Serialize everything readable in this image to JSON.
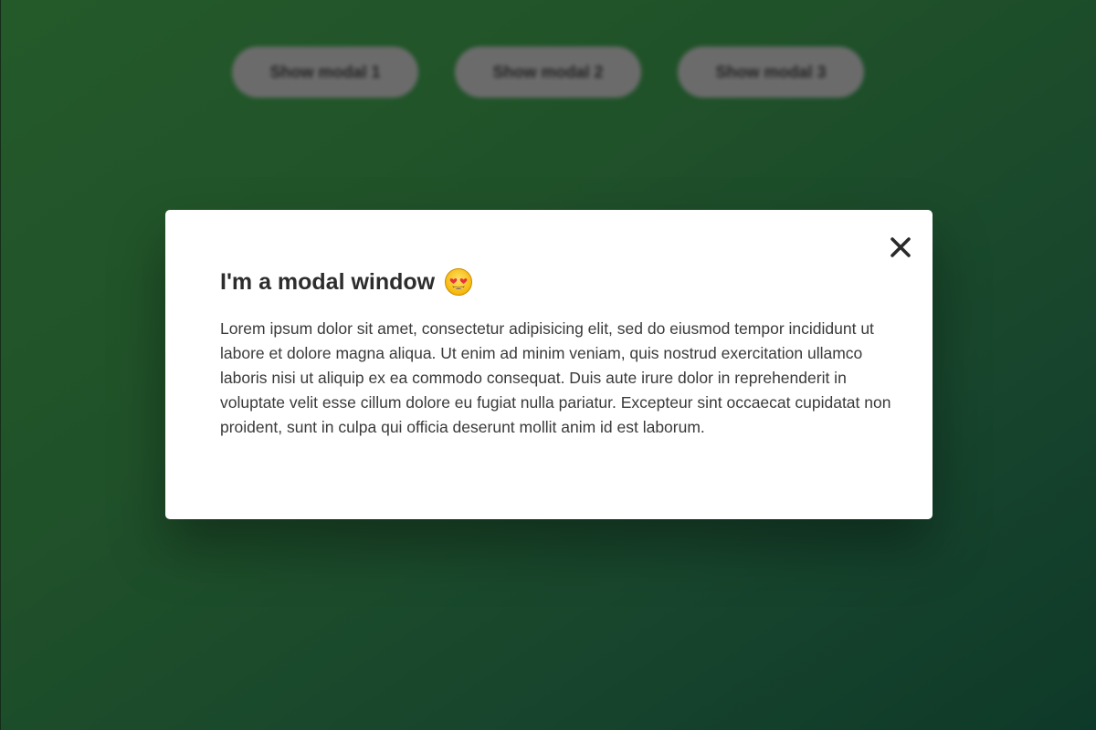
{
  "page": {
    "background_colors": [
      "#2f7336",
      "#134a36"
    ]
  },
  "buttons": [
    {
      "label": "Show modal 1"
    },
    {
      "label": "Show modal 2"
    },
    {
      "label": "Show modal 3"
    }
  ],
  "modal": {
    "title": "I'm a modal window",
    "title_icon": "heart-eyes-emoji-icon",
    "body": "Lorem ipsum dolor sit amet, consectetur adipisicing elit, sed do eiusmod tempor incididunt ut labore et dolore magna aliqua. Ut enim ad minim veniam, quis nostrud exercitation ullamco laboris nisi ut aliquip ex ea commodo consequat. Duis aute irure dolor in reprehenderit in voluptate velit esse cillum dolore eu fugiat nulla pariatur. Excepteur sint occaecat cupidatat non proident, sunt in culpa qui officia deserunt mollit anim id est laborum.",
    "close_icon": "close-icon"
  }
}
